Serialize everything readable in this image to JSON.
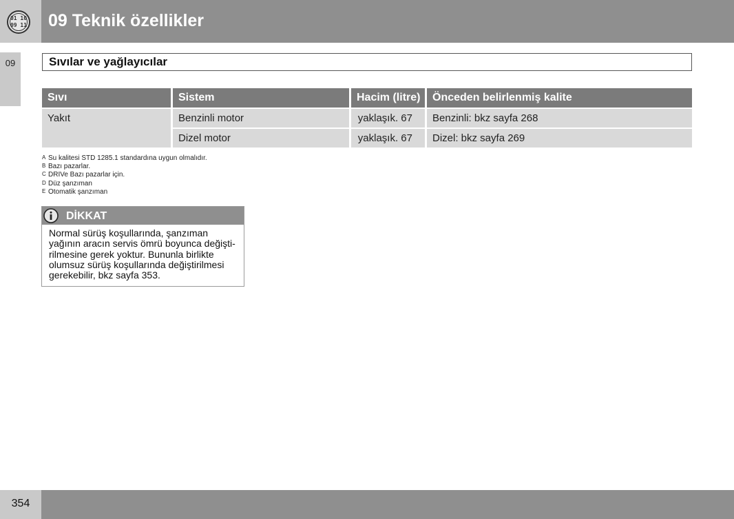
{
  "header": {
    "icon_text": "01 10\n09 11",
    "title": "09 Teknik özellikler"
  },
  "side_tab": {
    "label": "09"
  },
  "section": {
    "title": "Sıvılar ve yağlayıcılar"
  },
  "table": {
    "headers": [
      "Sıvı",
      "Sistem",
      "Hacim (litre)",
      "Önceden belirlenmiş kalite"
    ],
    "fluid": "Yakıt",
    "rows": [
      {
        "system": "Benzinli motor",
        "volume": "yaklaşık. 67",
        "quality": "Benzinli: bkz sayfa 268"
      },
      {
        "system": "Dizel motor",
        "volume": "yaklaşık. 67",
        "quality": "Dizel: bkz sayfa 269"
      }
    ]
  },
  "footnotes": [
    {
      "letter": "A",
      "text": "Su kalitesi STD 1285.1 standardına uygun olmalıdır."
    },
    {
      "letter": "B",
      "text": "Bazı pazarlar."
    },
    {
      "letter": "C",
      "text": "DRIVe Bazı pazarlar için."
    },
    {
      "letter": "D",
      "text": "Düz şanzıman"
    },
    {
      "letter": "E",
      "text": "Otomatik şanzıman"
    }
  ],
  "note": {
    "icon": "info-icon",
    "title": "DİKKAT",
    "lines": [
      "Normal sürüş koşullarında, şanzıman",
      "yağının aracın servis ömrü boyunca değişti-",
      "rilmesine gerek yoktur. Bununla birlikte",
      "olumsuz sürüş koşullarında değiştirilmesi",
      "gerekebilir, bkz sayfa 353."
    ]
  },
  "footer": {
    "page_number": "354"
  },
  "colors": {
    "header_dark": "#8f8f8f",
    "header_light": "#c9c9c9",
    "table_header": "#7b7b7b",
    "table_cell": "#d9d9d9"
  }
}
